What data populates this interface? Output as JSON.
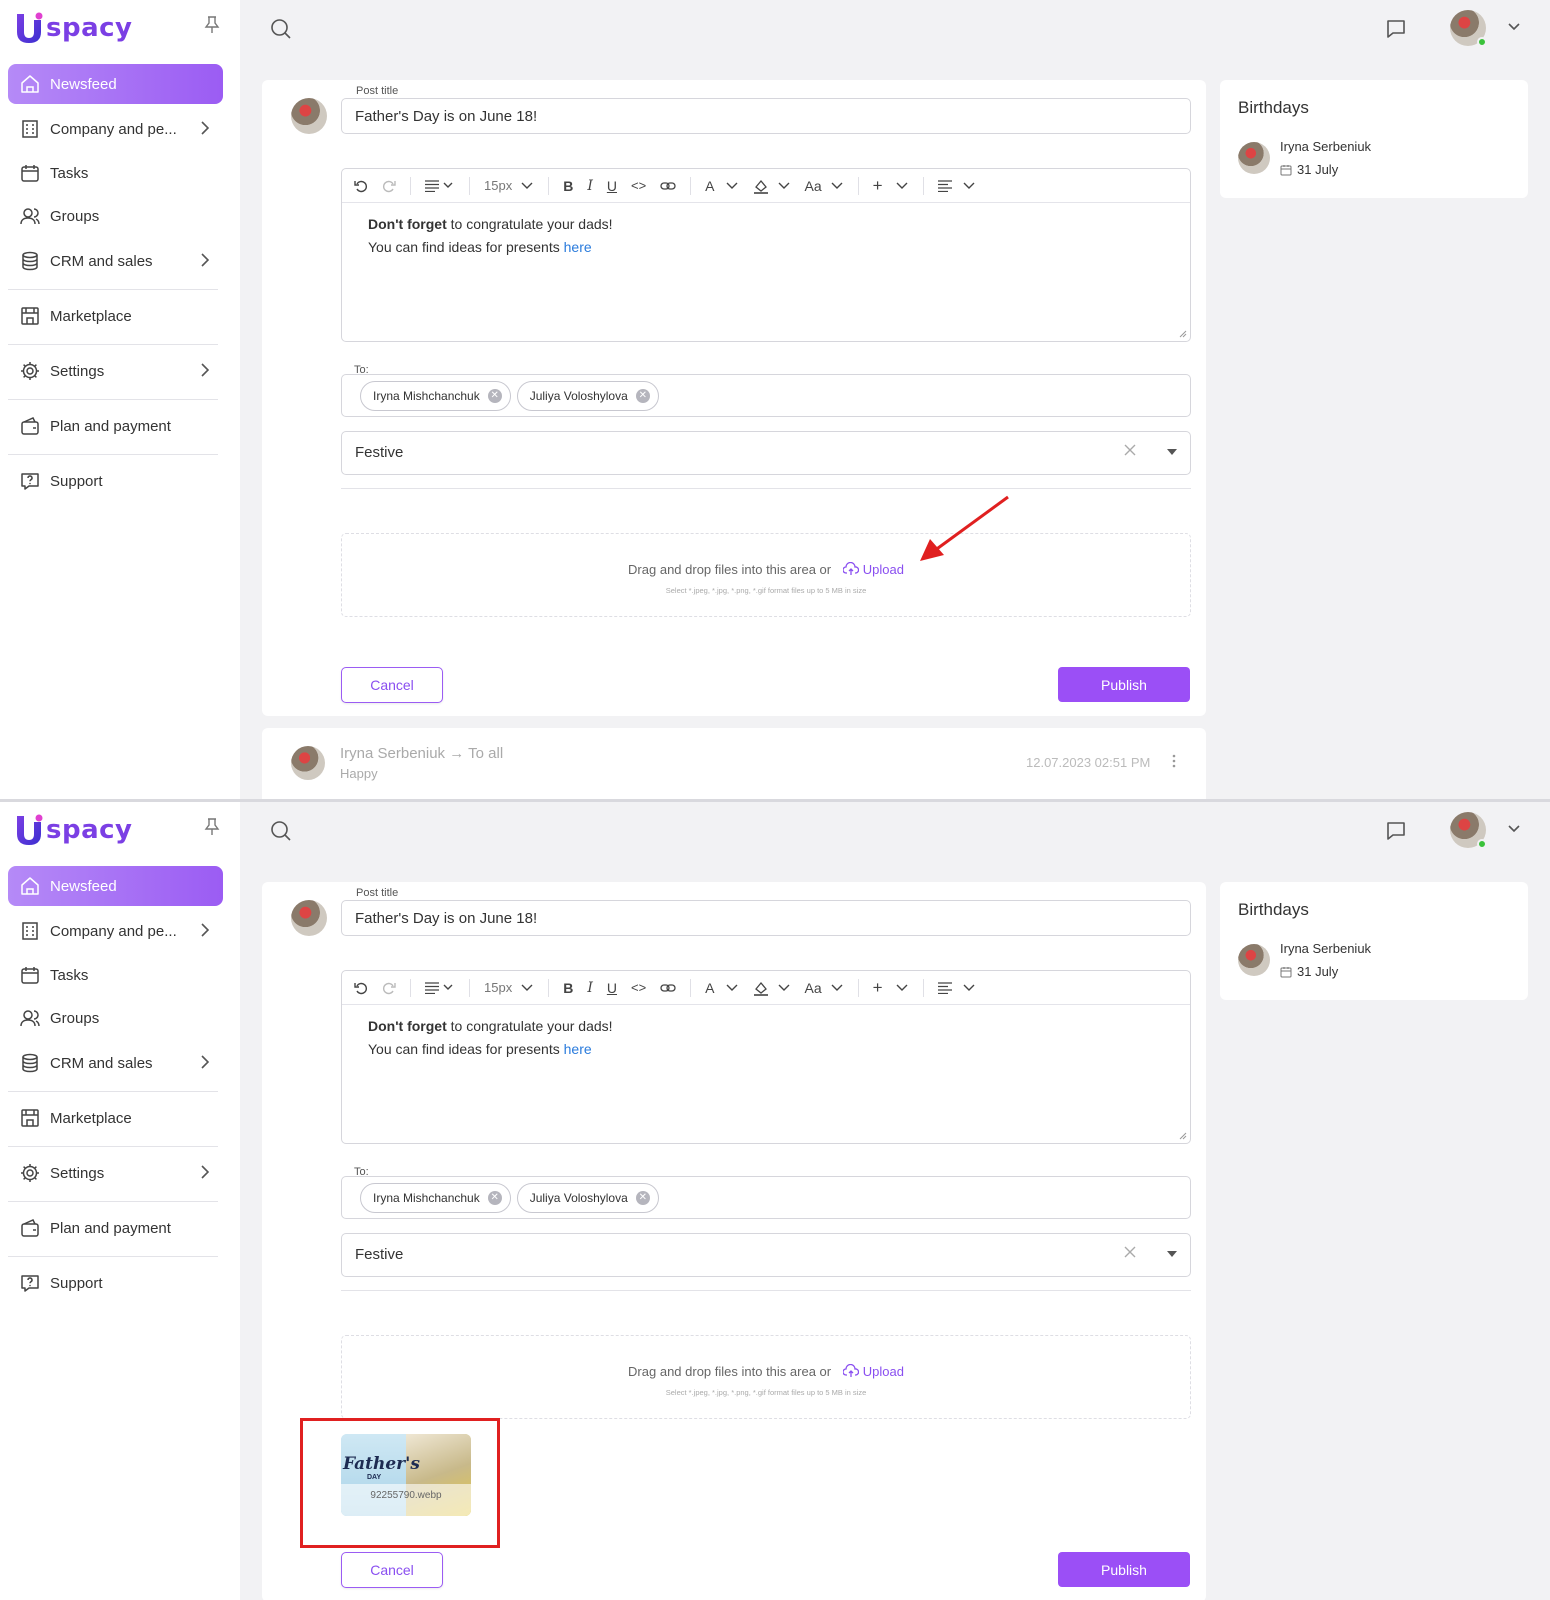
{
  "app": {
    "logo_text": "spacy"
  },
  "sidebar": {
    "items": [
      {
        "label": "Newsfeed",
        "icon": "home-icon",
        "active": true
      },
      {
        "label": "Company and pe...",
        "icon": "building-icon",
        "has_chevron": true
      },
      {
        "label": "Tasks",
        "icon": "calendar-icon"
      },
      {
        "label": "Groups",
        "icon": "users-icon"
      },
      {
        "label": "CRM and sales",
        "icon": "database-icon",
        "has_chevron": true
      },
      {
        "label": "Marketplace",
        "icon": "store-icon"
      },
      {
        "label": "Settings",
        "icon": "gear-icon",
        "has_chevron": true
      },
      {
        "label": "Plan and payment",
        "icon": "wallet-icon"
      },
      {
        "label": "Support",
        "icon": "help-icon"
      }
    ]
  },
  "post_form": {
    "title_label": "Post title",
    "title_value": "Father's Day is on June 18!",
    "toolbar": {
      "font_size": "15px",
      "bold": "B",
      "italic": "I",
      "underline": "U",
      "code": "<>",
      "font_color": "A",
      "text_case": "Aa",
      "insert": "+"
    },
    "body_bold": "Don't forget",
    "body_line1_rest": " to congratulate your dads!",
    "body_line2_text": "You can find ideas for presents ",
    "body_link": "here",
    "to_label": "To:",
    "recipients": [
      "Iryna Mishchanchuk",
      "Juliya Voloshylova"
    ],
    "category": "Festive",
    "dropzone_text": "Drag and drop files into this area or",
    "upload_label": "Upload",
    "dropzone_hint": "Select *.jpeg, *.jpg, *.png, *.gif format files up to 5 MB in size",
    "cancel_label": "Cancel",
    "publish_label": "Publish"
  },
  "attachment": {
    "thumb_title": "Father's",
    "thumb_day": "DAY",
    "file_name": "92255790.webp"
  },
  "feed_item": {
    "author": "Iryna Serbeniuk",
    "audience": "To all",
    "tag": "Happy",
    "date": "12.07.2023 02:51 PM"
  },
  "birthdays": {
    "title": "Birthdays",
    "name": "Iryna Serbeniuk",
    "date": "31 July"
  },
  "colors": {
    "accent": "#9b4ff6",
    "annotation": "#e02020"
  }
}
